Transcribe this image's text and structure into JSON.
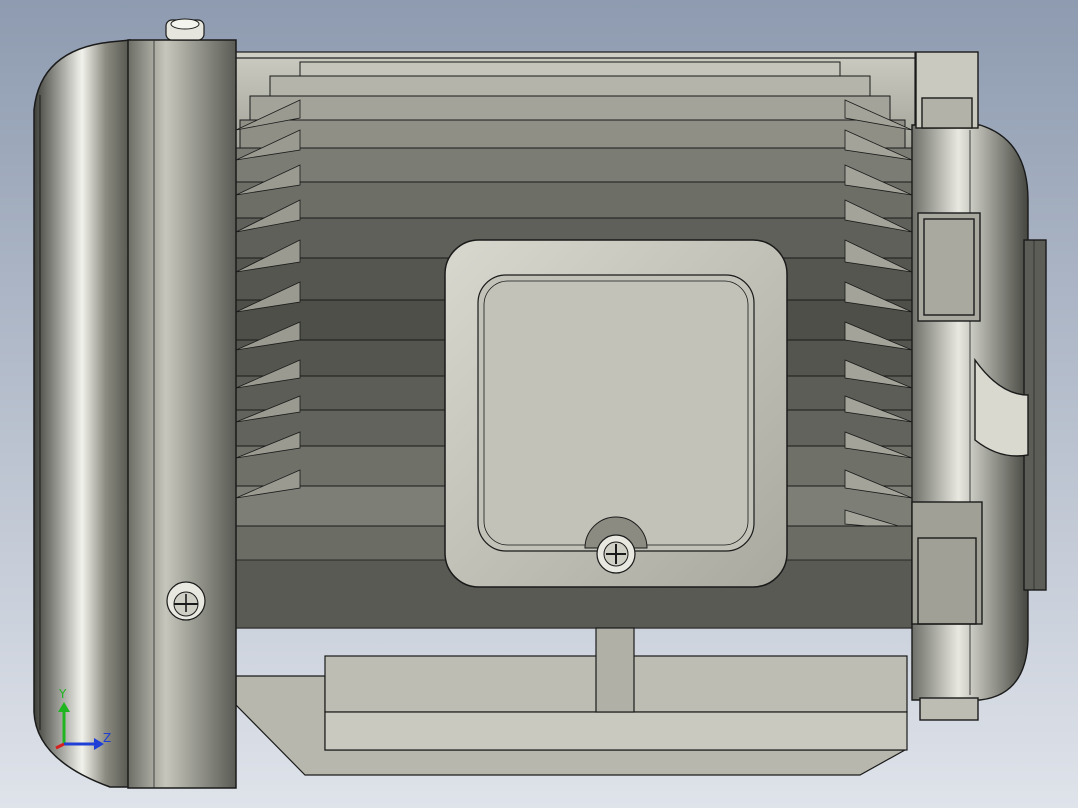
{
  "model": {
    "part": "electric-motor",
    "view": "side"
  },
  "triad": {
    "x_label": "Y",
    "y_label": "Z"
  },
  "colors": {
    "background_top": "#8e9bb0",
    "background_bottom": "#dfe3ea",
    "body_dark": "#4f5049",
    "body_light": "#d6d6cc",
    "edge": "#1a1a1a",
    "axis_y": "#1fb51f",
    "axis_z": "#1f3fd6",
    "axis_x": "#d61f1f"
  }
}
